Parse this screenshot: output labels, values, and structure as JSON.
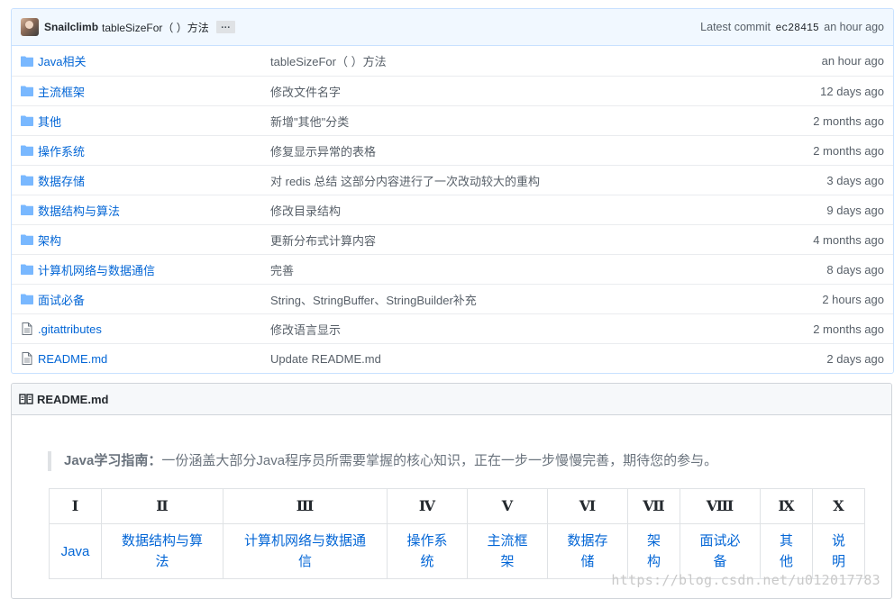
{
  "commit": {
    "author": "Snailclimb",
    "message": "tableSizeFor（ ）方法",
    "ellipsis": "…",
    "latest_label": "Latest commit",
    "sha": "ec28415",
    "age": "an hour ago"
  },
  "files": [
    {
      "name": "Java相关",
      "type": "folder",
      "message": "tableSizeFor（ ）方法",
      "age": "an hour ago"
    },
    {
      "name": "主流框架",
      "type": "folder",
      "message": "修改文件名字",
      "age": "12 days ago"
    },
    {
      "name": "其他",
      "type": "folder",
      "message": "新增\"其他\"分类",
      "age": "2 months ago"
    },
    {
      "name": "操作系统",
      "type": "folder",
      "message": "修复显示异常的表格",
      "age": "2 months ago"
    },
    {
      "name": "数据存储",
      "type": "folder",
      "message": "对 redis 总结 这部分内容进行了一次改动较大的重构",
      "age": "3 days ago"
    },
    {
      "name": "数据结构与算法",
      "type": "folder",
      "message": "修改目录结构",
      "age": "9 days ago"
    },
    {
      "name": "架构",
      "type": "folder",
      "message": "更新分布式计算内容",
      "age": "4 months ago"
    },
    {
      "name": "计算机网络与数据通信",
      "type": "folder",
      "message": "完善",
      "age": "8 days ago"
    },
    {
      "name": "面试必备",
      "type": "folder",
      "message": "String、StringBuffer、StringBuilder补充",
      "age": "2 hours ago"
    },
    {
      "name": ".gitattributes",
      "type": "file",
      "message": "修改语言显示",
      "age": "2 months ago"
    },
    {
      "name": "README.md",
      "type": "file",
      "message": "Update README.md",
      "age": "2 days ago"
    }
  ],
  "readme": {
    "title": "README.md",
    "quote_bold": "Java学习指南：",
    "quote_text": "一份涵盖大部分Java程序员所需要掌握的核心知识，正在一步一步慢慢完善，期待您的参与。",
    "table": {
      "headers": [
        "Ⅰ",
        "Ⅱ",
        "Ⅲ",
        "Ⅳ",
        "Ⅴ",
        "Ⅵ",
        "Ⅶ",
        "Ⅷ",
        "Ⅸ",
        "Ⅹ"
      ],
      "cells": [
        {
          "line1": "Java",
          "line2": ""
        },
        {
          "line1": "数据结构与算",
          "line2": "法"
        },
        {
          "line1": "计算机网络与数据通",
          "line2": "信"
        },
        {
          "line1": "操作系",
          "line2": "统"
        },
        {
          "line1": "主流框",
          "line2": "架"
        },
        {
          "line1": "数据存",
          "line2": "储"
        },
        {
          "line1": "架",
          "line2": "构"
        },
        {
          "line1": "面试必",
          "line2": "备"
        },
        {
          "line1": "其",
          "line2": "他"
        },
        {
          "line1": "说",
          "line2": "明"
        }
      ]
    }
  },
  "watermark": "https://blog.csdn.net/u012017783",
  "colors": {
    "link": "#0366d6",
    "folder_icon": "#79b8ff",
    "file_icon": "#6a737d"
  }
}
